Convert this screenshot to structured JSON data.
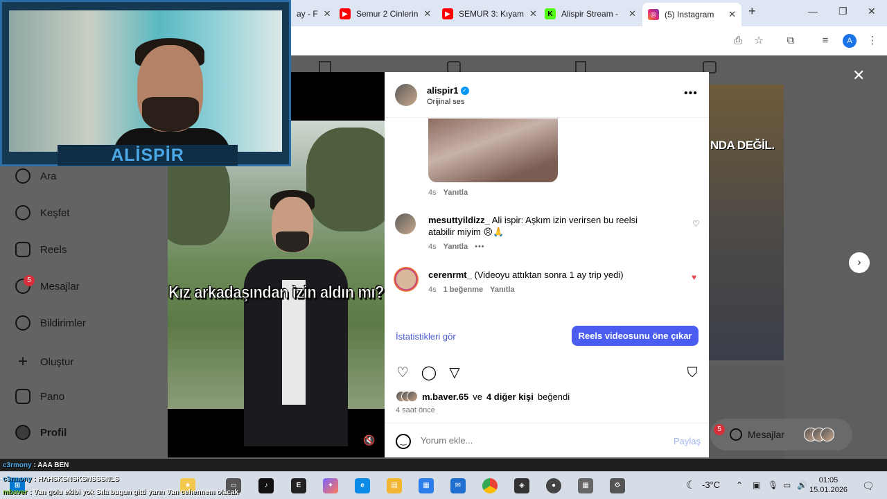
{
  "browser": {
    "tabs": [
      {
        "title": "ay - F",
        "favicon": "",
        "color": "#888888"
      },
      {
        "title": "Semur 2 Cinlerin",
        "favicon": "youtube-icon",
        "color": "#ff0000"
      },
      {
        "title": "SEMUR 3: Kıyam",
        "favicon": "youtube-icon",
        "color": "#ff0000"
      },
      {
        "title": "Alispir Stream -",
        "favicon": "kick-icon",
        "color": "#53fc18"
      },
      {
        "title": "(5) Instagram",
        "favicon": "instagram-icon",
        "color": "#d6249f"
      }
    ],
    "new_tab": "+",
    "profile_initial": "A"
  },
  "sidebar": {
    "items": [
      {
        "label": "Ara",
        "icon": "search-icon"
      },
      {
        "label": "Keşfet",
        "icon": "compass-icon"
      },
      {
        "label": "Reels",
        "icon": "reels-icon"
      },
      {
        "label": "Mesajlar",
        "icon": "messenger-icon",
        "badge": "5"
      },
      {
        "label": "Bildirimler",
        "icon": "heart-icon"
      },
      {
        "label": "Oluştur",
        "icon": "plus-icon"
      },
      {
        "label": "Pano",
        "icon": "chart-icon"
      },
      {
        "label": "Profil",
        "icon": "avatar"
      }
    ]
  },
  "video": {
    "caption": "Kız arkadaşından izin aldın mı?"
  },
  "right_reel": {
    "text": "NDA DEĞİL."
  },
  "post": {
    "username": "alispir1",
    "audio": "Orijinal ses",
    "gif_meta": {
      "time": "4s",
      "reply": "Yanıtla"
    },
    "comments": [
      {
        "user": "mesuttyildizz_",
        "text": "Ali ispir: Aşkım izin verirsen bu reelsi atabilir miyim 😣🙏",
        "time": "4s",
        "reply": "Yanıtla",
        "liked": false
      },
      {
        "user": "cerenrmt_",
        "text": "(Videoyu attıktan sonra 1 ay trip yedi)",
        "time": "4s",
        "likes": "1 beğenme",
        "reply": "Yanıtla",
        "liked": true
      }
    ],
    "stats_link": "İstatistikleri gör",
    "boost_button": "Reels videosunu öne çıkar",
    "liked_by_user": "m.baver.65",
    "liked_by_conj": "ve",
    "liked_by_others": "4 diğer kişi",
    "liked_by_suffix": "beğendi",
    "time_ago": "4 saat önce",
    "comment_placeholder": "Yorum ekle...",
    "post_button": "Paylaş"
  },
  "messages_pill": {
    "label": "Mesajlar",
    "badge": "5"
  },
  "webcam": {
    "name": "ALİSPİR"
  },
  "chat": [
    {
      "nick": "c3rmony",
      "msg": "AAA BEN"
    },
    {
      "nick": "c3rmony",
      "msg": "HAHSKSNSKSNSSSNLS"
    },
    {
      "nick": "mbaver",
      "msg": "Van golu ekibi yok Sıla bugun gitti yarın Van cehennem olacak"
    }
  ],
  "taskbar": {
    "temperature": "-3°C",
    "time": "01:05",
    "date": "15.01.2026"
  },
  "colors": {
    "accent": "#4a5df0",
    "like_red": "#ed4956",
    "verified": "#0095f6"
  }
}
